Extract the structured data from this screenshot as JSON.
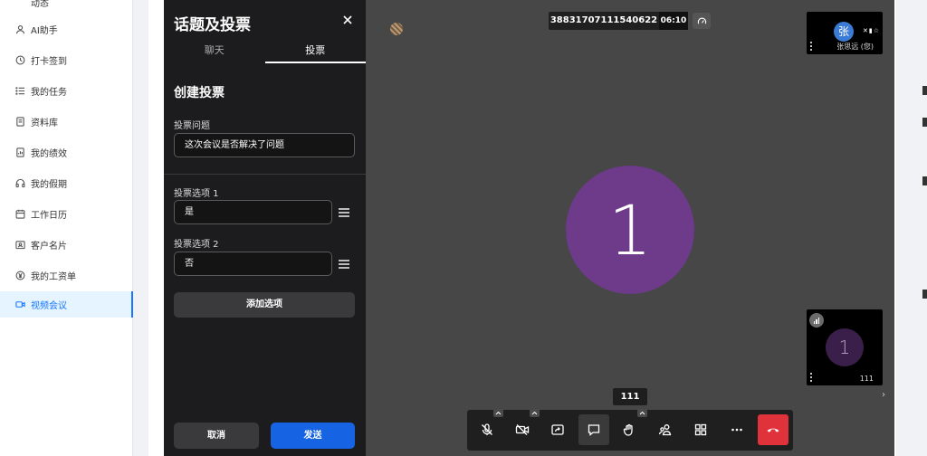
{
  "sidebar": {
    "items": [
      {
        "label": "动态",
        "icon": "feed-icon"
      },
      {
        "label": "AI助手",
        "icon": "user-icon"
      },
      {
        "label": "打卡签到",
        "icon": "clock-icon"
      },
      {
        "label": "我的任务",
        "icon": "list-icon"
      },
      {
        "label": "资料库",
        "icon": "document-icon"
      },
      {
        "label": "我的绩效",
        "icon": "report-icon"
      },
      {
        "label": "我的假期",
        "icon": "headphones-icon"
      },
      {
        "label": "工作日历",
        "icon": "calendar-icon"
      },
      {
        "label": "客户名片",
        "icon": "id-card-icon"
      },
      {
        "label": "我的工资单",
        "icon": "yen-icon"
      },
      {
        "label": "视频会议",
        "icon": "video-icon",
        "active": true
      }
    ]
  },
  "panel": {
    "title": "话题及投票",
    "tabs": [
      "聊天",
      "投票"
    ],
    "active_tab": "投票",
    "section_title": "创建投票",
    "question_label": "投票问题",
    "question_value": "这次会议是否解决了问题",
    "option1_label": "投票选项 1",
    "option1_value": "是",
    "option2_label": "投票选项 2",
    "option2_value": "否",
    "add_option": "添加选项",
    "cancel": "取消",
    "send": "发送"
  },
  "meeting": {
    "meeting_id": "38831707111540622",
    "timer": "06:10",
    "main_avatar": "1",
    "self_avatar": "张",
    "self_name": "张思远 (您)",
    "participant_avatar": "1",
    "participant_name": "111",
    "speaker_label": "111"
  },
  "colors": {
    "accent": "#1677ff",
    "send_button": "#1664e4",
    "hangup": "#e0323b",
    "main_avatar": "#6e3a8a",
    "self_avatar": "#3a7bd5"
  },
  "toolbar": {
    "buttons": [
      "mic-off-icon",
      "camera-off-icon",
      "share-screen-icon",
      "chat-icon",
      "raise-hand-icon",
      "participants-icon",
      "grid-icon",
      "more-icon",
      "hangup-icon"
    ]
  }
}
